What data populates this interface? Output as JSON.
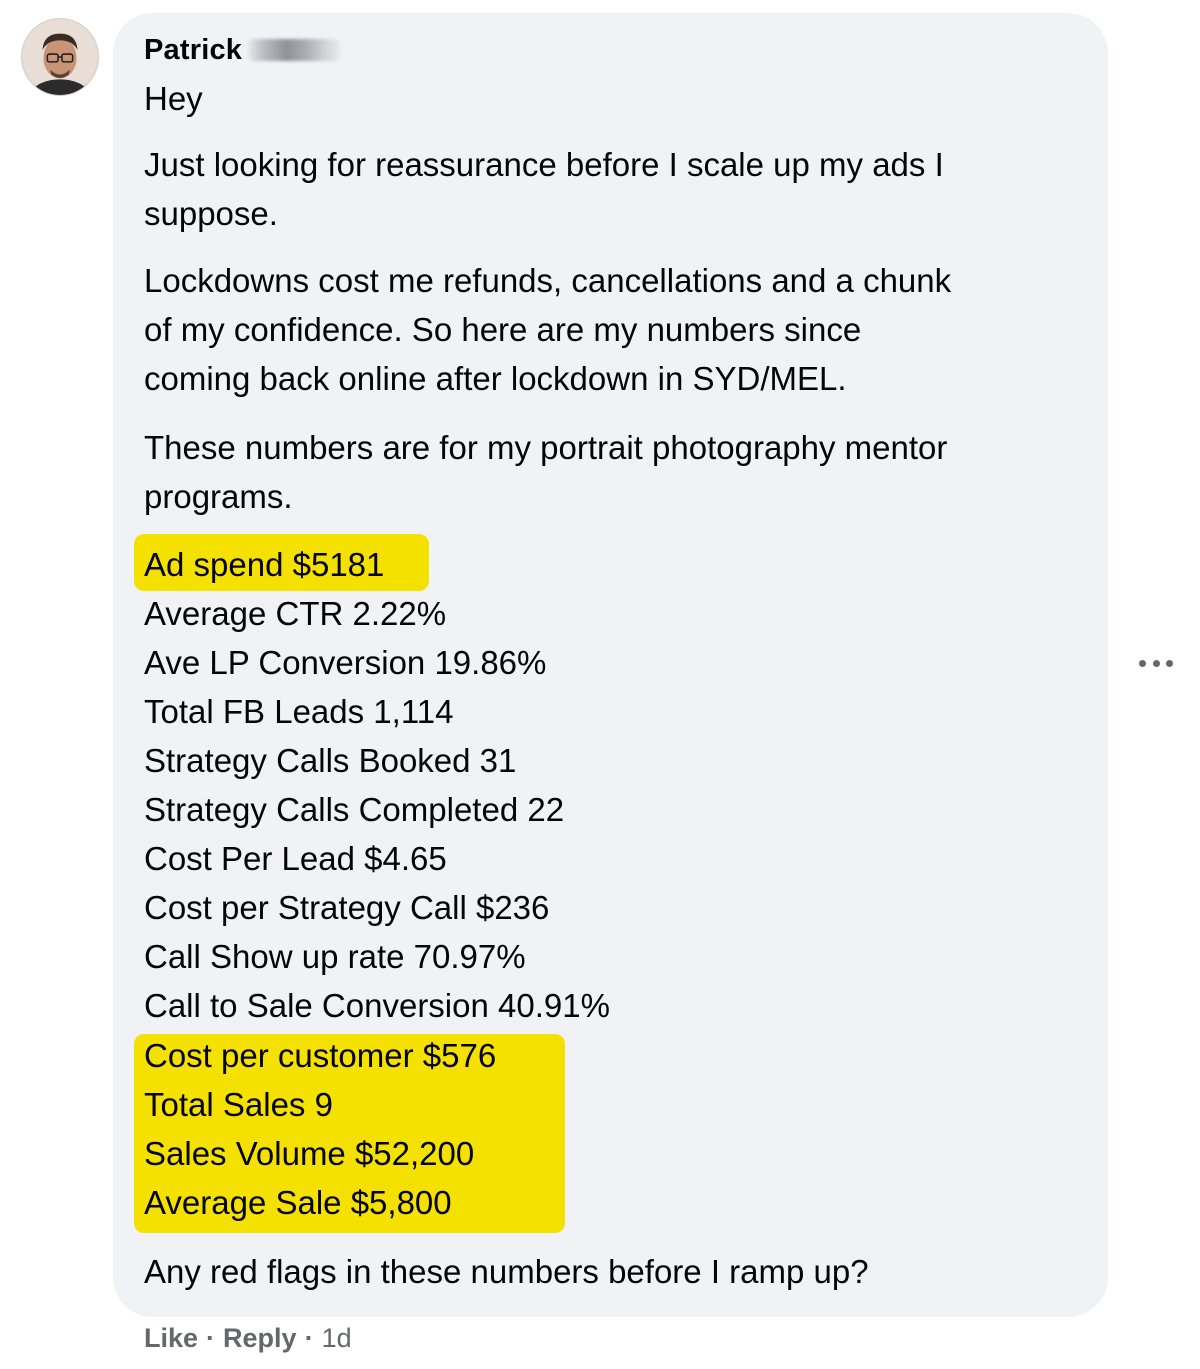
{
  "comment": {
    "author": "Patrick",
    "greeting": "Hey",
    "paragraphs": [
      [
        "Just looking for reassurance before I scale up my ads I",
        "suppose."
      ],
      [
        "Lockdowns cost me refunds, cancellations and a chunk",
        "of my confidence. So here are my numbers since",
        "coming back online after lockdown in SYD/MEL."
      ],
      [
        "These numbers are for my portrait photography mentor",
        "programs."
      ]
    ],
    "stats": [
      "Ad spend $5181",
      "Average CTR 2.22%",
      "Ave LP Conversion 19.86%",
      "Total FB Leads 1,114",
      "Strategy Calls Booked 31",
      "Strategy Calls Completed 22",
      "Cost Per Lead $4.65",
      "Cost per Strategy Call $236",
      "Call Show up rate 70.97%",
      "Call to Sale Conversion 40.91%",
      "Cost per customer $576",
      "Total Sales 9",
      "Sales Volume $52,200",
      "Average Sale $5,800"
    ],
    "closing": "Any red flags in these numbers before I ramp up?"
  },
  "actions": {
    "like": "Like",
    "separator": "·",
    "reply": "Reply",
    "time": "1d"
  },
  "colors": {
    "bubble": "#f0f2f5",
    "highlight": "#f4e100",
    "meta": "#65676b"
  },
  "icons": {
    "more": "more-horizontal-icon",
    "avatar": "user-avatar"
  }
}
